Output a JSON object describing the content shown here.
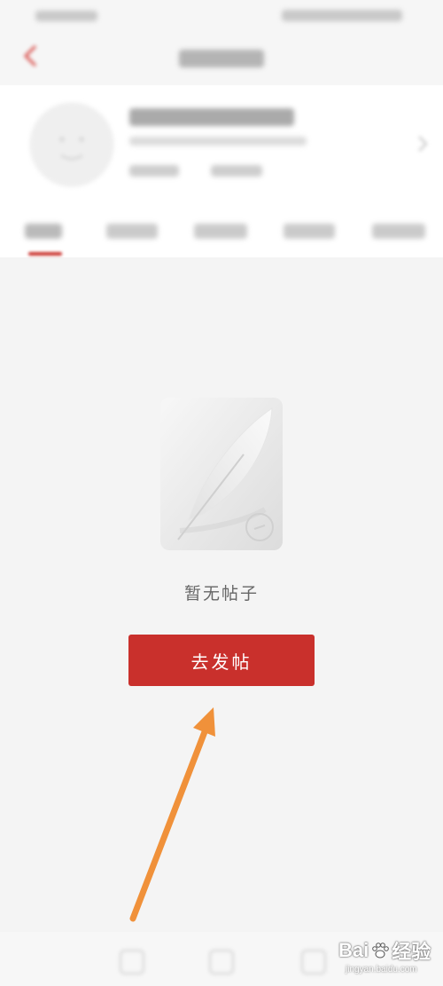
{
  "colors": {
    "accent": "#c9302c",
    "background": "#f4f4f4",
    "annotation": "#f0913a",
    "message_text": "#666666"
  },
  "status_bar": {
    "content": "blurred"
  },
  "header": {
    "back_icon": "chevron-left-icon"
  },
  "profile": {
    "avatar_icon": "avatar-placeholder-icon",
    "arrow_icon": "chevron-right-icon"
  },
  "tabs": {
    "count": 5,
    "active_index": 0
  },
  "empty_state": {
    "illustration_icon": "feather-paper-icon",
    "message": "暂无帖子",
    "button_label": "去发帖"
  },
  "bottom_nav": {
    "icons": [
      "nav-icon",
      "nav-icon",
      "nav-icon"
    ]
  },
  "annotation": {
    "icon": "arrow-up-icon"
  },
  "watermark": {
    "text_left": "Bai",
    "text_right": "经验",
    "url": "jingyan.baidu.com"
  }
}
